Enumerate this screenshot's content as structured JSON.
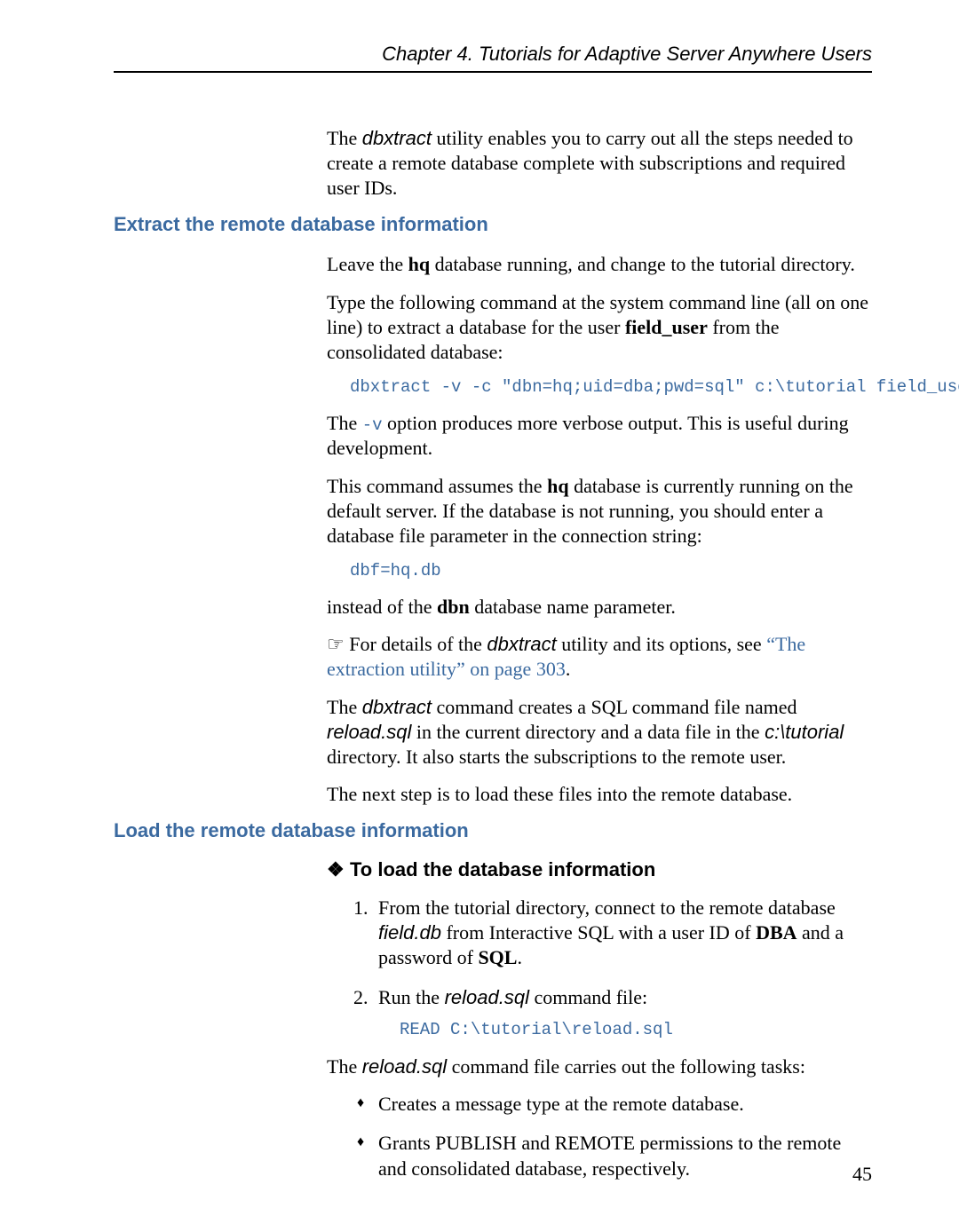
{
  "header": {
    "running_head": "Chapter 4.   Tutorials for Adaptive Server Anywhere Users"
  },
  "intro": {
    "p1a": "The ",
    "p1b": "dbxtract",
    "p1c": " utility enables you to carry out all the steps needed to create a remote database complete with subscriptions and required user IDs."
  },
  "section1": {
    "heading": "Extract the remote database information",
    "p1a": "Leave the ",
    "p1b": "hq",
    "p1c": " database running, and change to the tutorial directory.",
    "p2a": "Type the following command at the system command line (all on one line) to extract a database for the user ",
    "p2b": "field_user",
    "p2c": " from the consolidated database:",
    "code1": "dbxtract -v -c \"dbn=hq;uid=dba;pwd=sql\" c:\\tutorial field_user",
    "p3a": "The ",
    "p3b": "-v",
    "p3c": " option produces more verbose output. This is useful during development.",
    "p4a": "This command assumes the ",
    "p4b": "hq",
    "p4c": " database is currently running on the default server. If the database is not running, you should enter a database file parameter in the connection string:",
    "code2": "dbf=hq.db",
    "p5a": "instead of the ",
    "p5b": "dbn",
    "p5c": " database name parameter.",
    "p6a": "☞  For details of the ",
    "p6b": "dbxtract",
    "p6c": " utility and its options, see ",
    "p6link": "“The extraction utility” on page 303",
    "p6d": ".",
    "p7a": "The ",
    "p7b": "dbxtract",
    "p7c": " command creates a SQL command file named ",
    "p7d": "reload.sql",
    "p7e": " in the current directory and a data file in the ",
    "p7f": "c:\\tutorial",
    "p7g": " directory. It also starts the subscriptions to the remote user.",
    "p8": "The next step is to load these files into the remote database."
  },
  "section2": {
    "heading": "Load the remote database information",
    "task_icon": "❖",
    "task_heading": "To load the database information",
    "step1a": "From the tutorial directory, connect to the remote database ",
    "step1b": "field.db",
    "step1c": " from Interactive SQL with a user ID of ",
    "step1d": "DBA",
    "step1e": " and a password of ",
    "step1f": "SQL",
    "step1g": ".",
    "step2a": "Run the ",
    "step2b": "reload.sql",
    "step2c": " command file:",
    "step2code": "READ C:\\tutorial\\reload.sql",
    "p1a": "The ",
    "p1b": "reload.sql",
    "p1c": " command file carries out the following tasks:",
    "bullet1": "Creates a message type at the remote database.",
    "bullet2": "Grants PUBLISH and REMOTE permissions to the remote and consolidated database, respectively."
  },
  "footer": {
    "page_number": "45"
  }
}
